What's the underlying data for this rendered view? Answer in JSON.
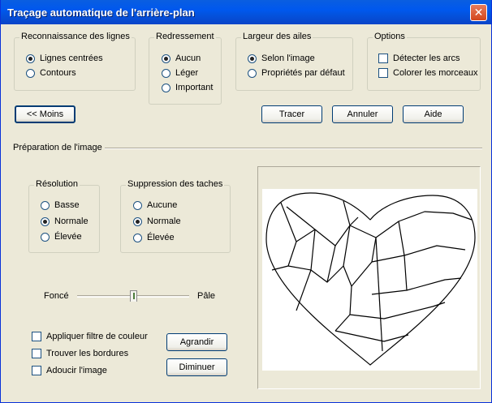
{
  "window": {
    "title": "Traçage automatique de l'arrière-plan",
    "close_glyph": "✕"
  },
  "recognition": {
    "legend": "Reconnaissance des lignes",
    "options": [
      "Lignes centrées",
      "Contours"
    ],
    "selected": "Lignes centrées"
  },
  "straightening": {
    "legend": "Redressement",
    "options": [
      "Aucun",
      "Léger",
      "Important"
    ],
    "selected": "Aucun"
  },
  "wing_width": {
    "legend": "Largeur des ailes",
    "options": [
      "Selon l'image",
      "Propriétés par défaut"
    ],
    "selected": "Selon l'image"
  },
  "options": {
    "legend": "Options",
    "checks": [
      {
        "label": "Détecter les arcs",
        "checked": false
      },
      {
        "label": "Colorer les morceaux",
        "checked": false
      }
    ]
  },
  "buttons": {
    "less": "<< Moins",
    "trace": "Tracer",
    "cancel": "Annuler",
    "help": "Aide",
    "enlarge": "Agrandir",
    "shrink": "Diminuer"
  },
  "prep_section": {
    "label": "Préparation de l'image"
  },
  "resolution": {
    "legend": "Résolution",
    "options": [
      "Basse",
      "Normale",
      "Élevée"
    ],
    "selected": "Normale"
  },
  "spot_removal": {
    "legend": "Suppression des taches",
    "options": [
      "Aucune",
      "Normale",
      "Élevée"
    ],
    "selected": "Normale"
  },
  "darkness_slider": {
    "min_label": "Foncé",
    "max_label": "Pâle",
    "value_fraction": 0.5
  },
  "filters": [
    {
      "label": "Appliquer filtre de couleur",
      "checked": false
    },
    {
      "label": "Trouver les bordures",
      "checked": false
    },
    {
      "label": "Adoucir l'image",
      "checked": false
    }
  ]
}
